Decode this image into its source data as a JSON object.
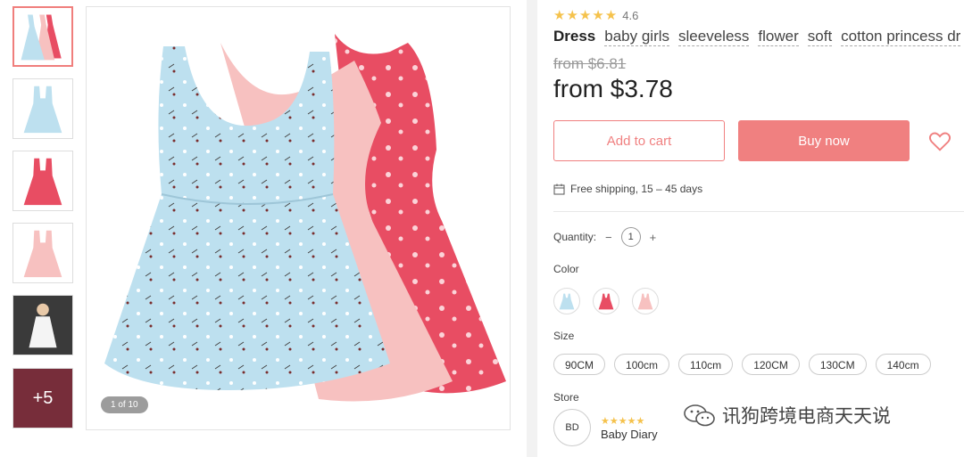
{
  "gallery": {
    "thumbnails": [
      {
        "name": "thumb-dresses-trio",
        "active": true
      },
      {
        "name": "thumb-blue-dress"
      },
      {
        "name": "thumb-red-dress"
      },
      {
        "name": "thumb-pink-dress"
      },
      {
        "name": "thumb-model-photo"
      },
      {
        "name": "thumb-more",
        "more_label": "+5"
      }
    ],
    "counter_label": "1 of 10"
  },
  "product": {
    "rating_stars": "★★★★★",
    "rating_value": "4.6",
    "tags": [
      "Dress",
      "baby girls",
      "sleeveless",
      "flower",
      "soft",
      "cotton princess dr"
    ],
    "old_price": "from $6.81",
    "new_price": "from $3.78",
    "add_to_cart_label": "Add to cart",
    "buy_now_label": "Buy now",
    "shipping_text": "Free shipping, 15 – 45 days",
    "quantity_label": "Quantity:",
    "quantity_minus": "−",
    "quantity_value": "1",
    "quantity_plus": "+",
    "color_label": "Color",
    "colors": [
      "light-blue",
      "red",
      "pink"
    ],
    "size_label": "Size",
    "sizes": [
      "90CM",
      "100cm",
      "110cm",
      "120CM",
      "130CM",
      "140cm"
    ],
    "store_label": "Store",
    "store_initials": "BD",
    "store_stars": "★★★★★",
    "store_name": "Baby Diary"
  },
  "watermark": {
    "text": "讯狗跨境电商天天说"
  },
  "colors": {
    "accent": "#f08080",
    "star": "#f5c24c",
    "dress_blue": "#bde0ef",
    "dress_pink": "#f7c1c0",
    "dress_red": "#e84d63"
  }
}
